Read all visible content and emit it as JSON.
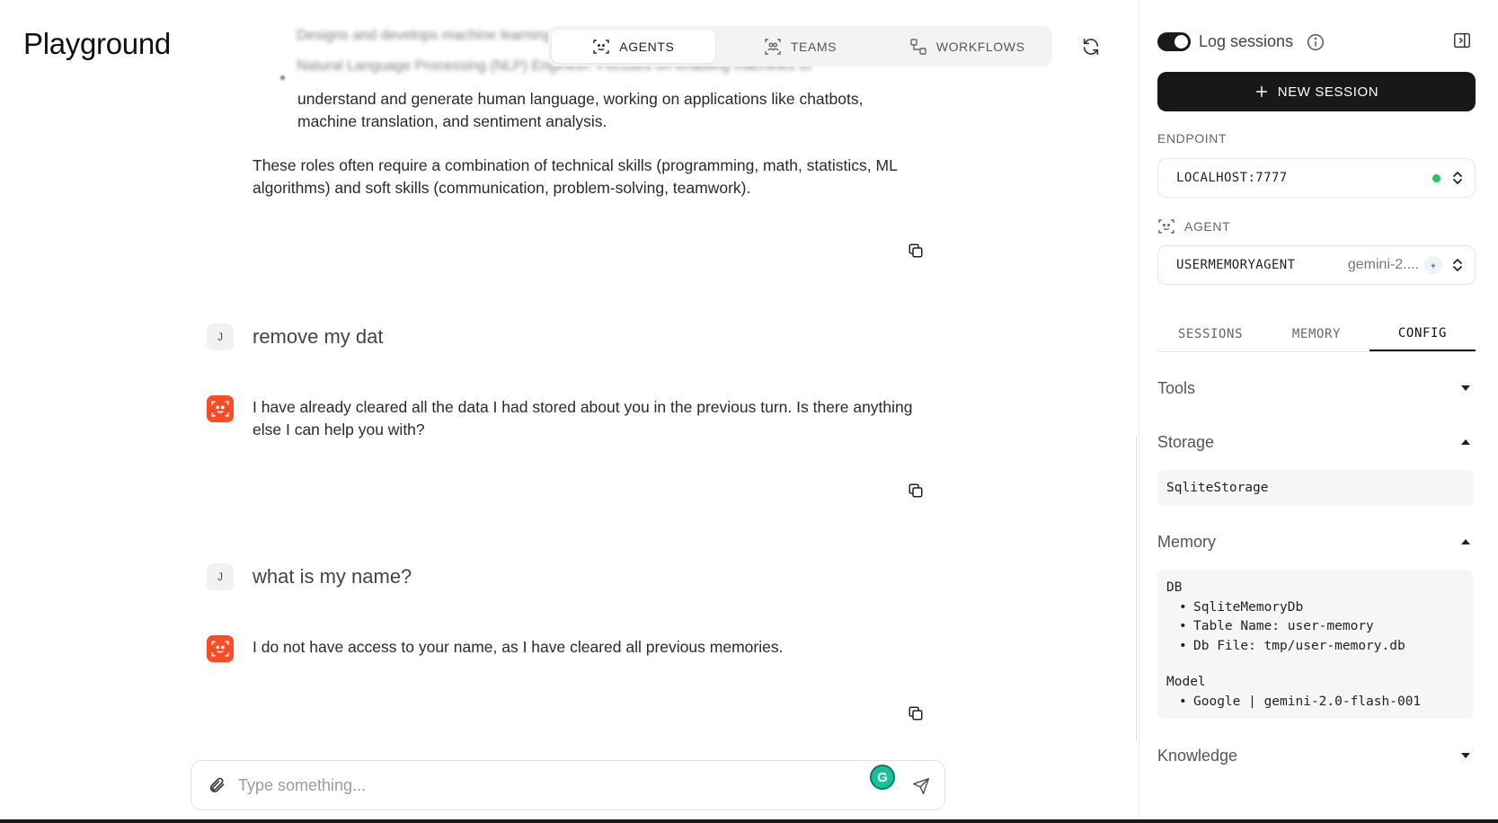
{
  "main": {
    "title": "Playground",
    "mode_tabs": [
      {
        "label": "AGENTS",
        "icon": "agent-icon",
        "active": true
      },
      {
        "label": "TEAMS",
        "icon": "team-icon",
        "active": false
      },
      {
        "label": "WORKFLOWS",
        "icon": "workflow-icon",
        "active": false
      }
    ],
    "blurred_line_1": "Designs and develops machine learning algorithms for autonomous vehicles.",
    "blurred_line_2": "Natural Language Processing (NLP) Engineer: Focuses on enabling machines to",
    "nlp_continuation_1": "understand and generate human language, working on applications like chatbots,",
    "nlp_continuation_2": "machine translation, and sentiment analysis.",
    "summary_1": "These roles often require a combination of technical skills (programming, math, statistics, ML",
    "summary_2": "algorithms) and soft skills (communication, problem-solving, teamwork).",
    "messages": [
      {
        "role": "user",
        "avatar": "J",
        "text": "remove my dat"
      },
      {
        "role": "agent",
        "text_1": "I have already cleared all the data I had stored about you in the previous turn. Is there anything",
        "text_2": "else I can help you with?"
      },
      {
        "role": "user",
        "avatar": "J",
        "text": "what is my name?"
      },
      {
        "role": "agent",
        "text_1": "I do not have access to your name, as I have cleared all previous memories."
      }
    ],
    "composer": {
      "placeholder": "Type something..."
    },
    "grammarly_letter": "G"
  },
  "sidebar": {
    "log_sessions_label": "Log sessions",
    "log_sessions_on": true,
    "new_session_label": "NEW SESSION",
    "endpoint_label": "ENDPOINT",
    "endpoint_value": "LOCALHOST:7777",
    "endpoint_status_color": "#22c55e",
    "agent_label": "AGENT",
    "agent_value": "USERMEMORYAGENT",
    "agent_model": "gemini-2....",
    "tabs": [
      {
        "label": "SESSIONS",
        "active": false
      },
      {
        "label": "MEMORY",
        "active": false
      },
      {
        "label": "CONFIG",
        "active": true
      }
    ],
    "config": {
      "tools_label": "Tools",
      "storage_label": "Storage",
      "storage_value": "SqliteStorage",
      "memory_label": "Memory",
      "memory_db_heading": "DB",
      "memory_db_items": [
        "SqliteMemoryDb",
        "Table Name: user-memory",
        "Db File: tmp/user-memory.db"
      ],
      "memory_model_heading": "Model",
      "memory_model_items": [
        "Google | gemini-2.0-flash-001"
      ],
      "knowledge_label": "Knowledge"
    }
  },
  "colors": {
    "agent_avatar": "#ff4b24",
    "primary_button": "#18181a"
  }
}
